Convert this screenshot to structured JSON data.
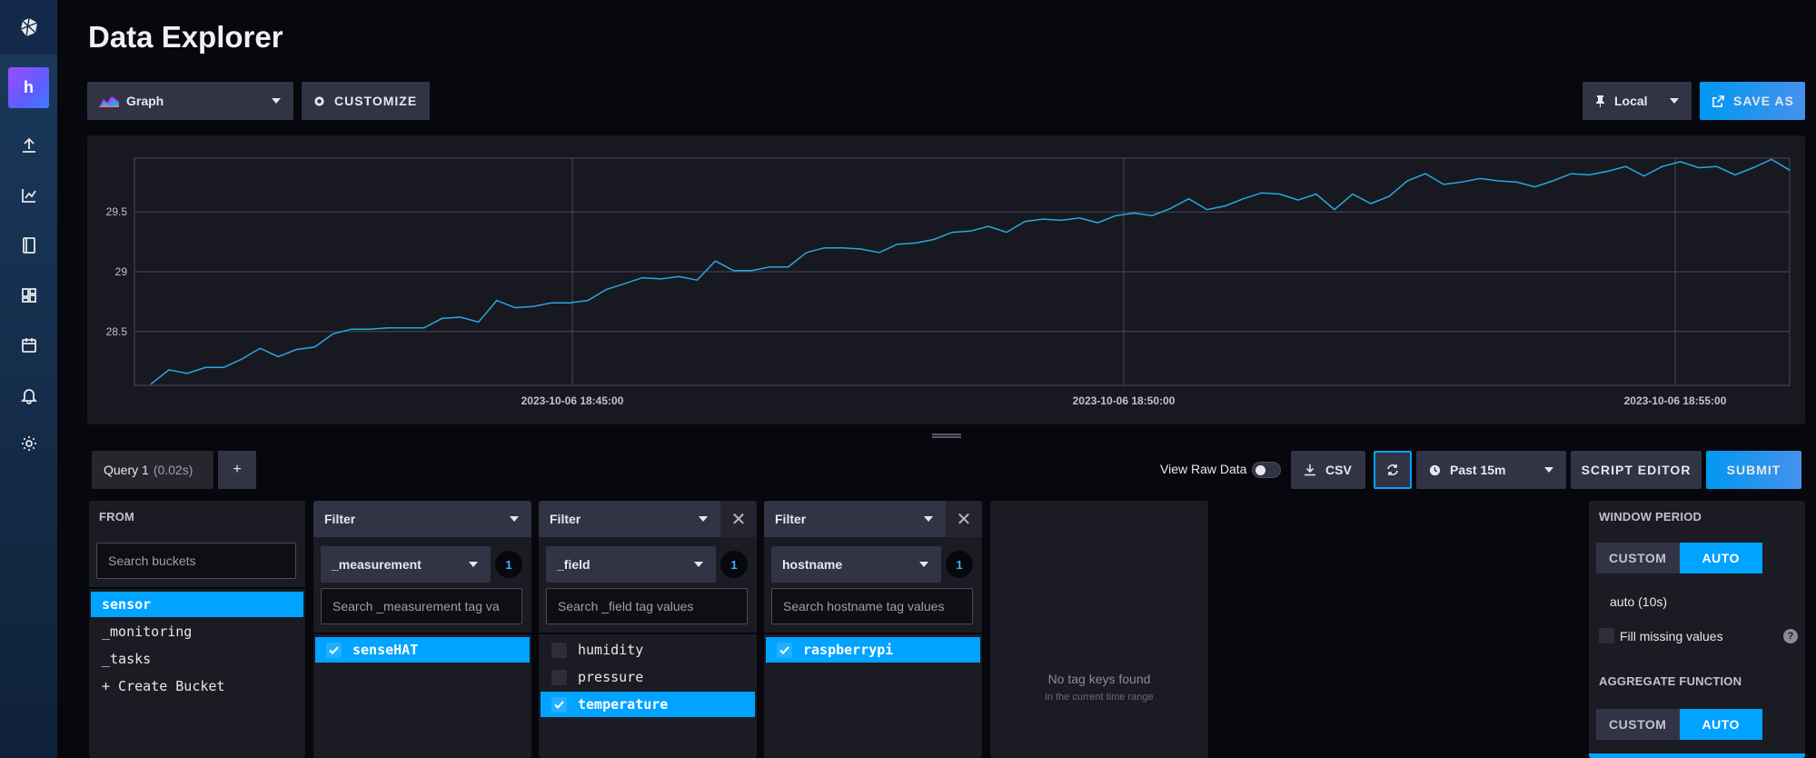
{
  "page": {
    "title": "Data Explorer"
  },
  "nav": {
    "org_initial": "h"
  },
  "toolbar": {
    "vis_type": "Graph",
    "customize": "CUSTOMIZE",
    "timezone": "Local",
    "save_as": "SAVE AS"
  },
  "chart_data": {
    "type": "line",
    "y_ticks": [
      "28.5",
      "29",
      "29.5"
    ],
    "x_ticks": [
      "2023-10-06 18:45:00",
      "2023-10-06 18:50:00",
      "2023-10-06 18:55:00"
    ],
    "ylim": [
      28.05,
      29.95
    ],
    "xlim": [
      0,
      100
    ],
    "grid": true,
    "series": [
      {
        "color": "#29a7e1",
        "values": [
          28.06,
          28.18,
          28.15,
          28.2,
          28.2,
          28.27,
          28.36,
          28.29,
          28.35,
          28.37,
          28.48,
          28.52,
          28.52,
          28.53,
          28.53,
          28.53,
          28.61,
          28.62,
          28.58,
          28.76,
          28.7,
          28.71,
          28.74,
          28.74,
          28.76,
          28.85,
          28.9,
          28.95,
          28.94,
          28.96,
          28.93,
          29.09,
          29.01,
          29.01,
          29.04,
          29.04,
          29.16,
          29.2,
          29.2,
          29.19,
          29.16,
          29.23,
          29.24,
          29.27,
          29.33,
          29.34,
          29.38,
          29.33,
          29.42,
          29.44,
          29.43,
          29.45,
          29.41,
          29.47,
          29.49,
          29.47,
          29.53,
          29.61,
          29.52,
          29.55,
          29.61,
          29.66,
          29.65,
          29.6,
          29.65,
          29.52,
          29.65,
          29.57,
          29.63,
          29.76,
          29.82,
          29.73,
          29.75,
          29.78,
          29.76,
          29.75,
          29.71,
          29.76,
          29.82,
          29.81,
          29.84,
          29.88,
          29.8,
          29.88,
          29.92,
          29.87,
          29.88,
          29.81,
          29.87,
          29.94,
          29.85
        ]
      }
    ]
  },
  "queries": {
    "tab_label": "Query 1",
    "tab_time": "(0.02s)",
    "add": "+",
    "view_raw": "View Raw Data",
    "csv": "CSV",
    "time_range": "Past 15m",
    "script_editor": "SCRIPT EDITOR",
    "submit": "SUBMIT"
  },
  "from": {
    "label": "FROM",
    "search_placeholder": "Search buckets",
    "buckets": [
      "sensor",
      "_monitoring",
      "_tasks",
      "+ Create Bucket"
    ]
  },
  "filters": [
    {
      "title": "Filter",
      "key": "_measurement",
      "count": "1",
      "placeholder": "Search _measurement tag va",
      "values": [
        "senseHAT"
      ]
    },
    {
      "title": "Filter",
      "key": "_field",
      "count": "1",
      "placeholder": "Search _field tag values",
      "values": [
        "humidity",
        "pressure",
        "temperature"
      ]
    },
    {
      "title": "Filter",
      "key": "hostname",
      "count": "1",
      "placeholder": "Search hostname tag values",
      "values": [
        "raspberrypi"
      ]
    }
  ],
  "empty": {
    "title": "No tag keys found",
    "sub": "in the current time range"
  },
  "settings": {
    "window_label": "WINDOW PERIOD",
    "custom": "CUSTOM",
    "auto": "AUTO",
    "auto_value": "auto (10s)",
    "fill_missing": "Fill missing values",
    "help": "?",
    "aggregate_label": "AGGREGATE FUNCTION"
  }
}
